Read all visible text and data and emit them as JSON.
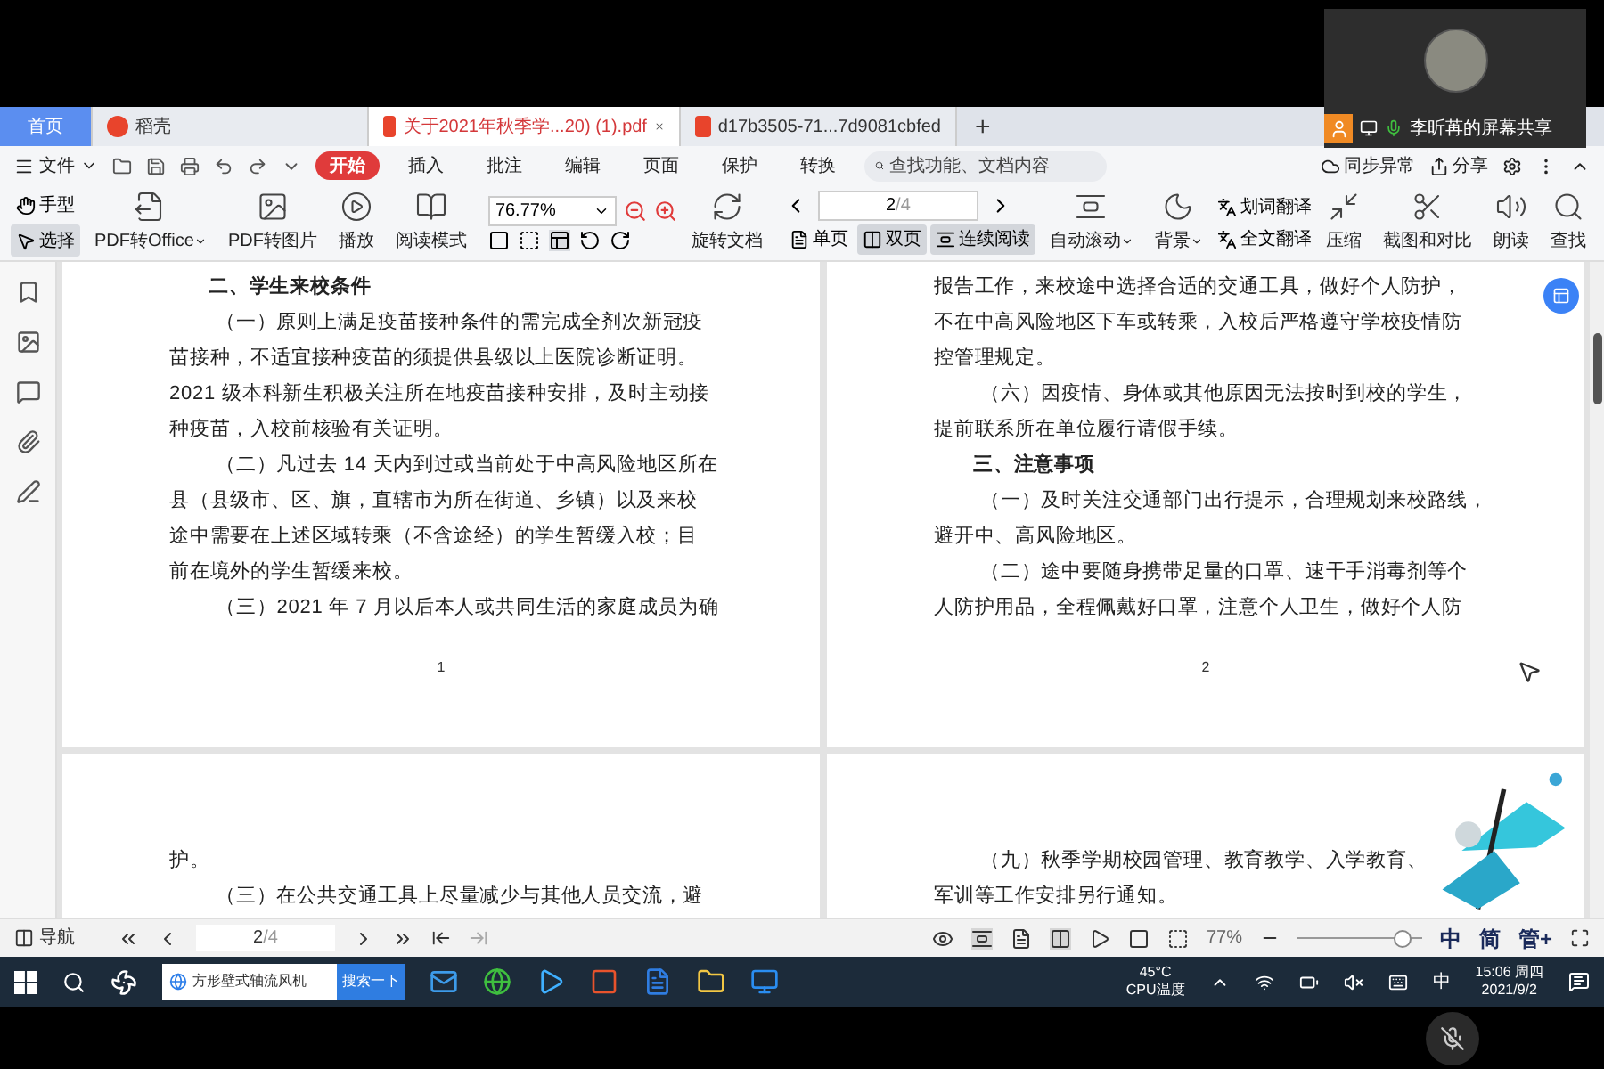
{
  "screen_share": {
    "label": "李昕苒的屏幕共享"
  },
  "tabs": [
    {
      "label": "首页",
      "kind": "home",
      "selected": false
    },
    {
      "label": "稻壳",
      "kind": "docer",
      "selected": false
    },
    {
      "label": "关于2021年秋季学...20) (1).pdf",
      "kind": "pdf",
      "selected": true
    },
    {
      "label": "d17b3505-71...7d9081cbfed",
      "kind": "pdf",
      "selected": false
    }
  ],
  "new_tab": "+",
  "menu": {
    "file": "文件",
    "items": [
      {
        "label": "开始",
        "selected": true
      },
      {
        "label": "插入",
        "selected": false
      },
      {
        "label": "批注",
        "selected": false
      },
      {
        "label": "编辑",
        "selected": false
      },
      {
        "label": "页面",
        "selected": false
      },
      {
        "label": "保护",
        "selected": false
      },
      {
        "label": "转换",
        "selected": false
      }
    ],
    "search_placeholder": "查找功能、文档内容",
    "sync": "同步异常",
    "share": "分享"
  },
  "toolbar": {
    "cursor_tools": [
      {
        "label": "手型",
        "selected": false
      },
      {
        "label": "选择",
        "selected": true
      }
    ],
    "buttons_a": [
      {
        "label": "PDF转Office",
        "dropdown": true
      },
      {
        "label": "PDF转图片",
        "dropdown": false
      },
      {
        "label": "播放",
        "dropdown": false
      },
      {
        "label": "阅读模式",
        "dropdown": false
      }
    ],
    "zoom": "76.77%",
    "rotate": "旋转文档",
    "page_current": "2",
    "page_total": "/4",
    "view_modes": [
      {
        "label": "单页",
        "selected": false
      },
      {
        "label": "双页",
        "selected": true
      },
      {
        "label": "连续阅读",
        "selected": true
      }
    ],
    "buttons_b": [
      {
        "label": "自动滚动",
        "dropdown": true
      },
      {
        "label": "背景",
        "dropdown": true
      }
    ],
    "translate": [
      {
        "label": "划词翻译"
      },
      {
        "label": "全文翻译"
      }
    ],
    "buttons_c": [
      {
        "label": "压缩",
        "dropdown": false
      },
      {
        "label": "截图和对比",
        "dropdown": false
      },
      {
        "label": "朗读",
        "dropdown": false
      },
      {
        "label": "查找",
        "dropdown": false
      }
    ]
  },
  "pages": [
    {
      "page_number": "1",
      "lines": [
        {
          "kind": "heading",
          "text": "二、学生来校条件"
        },
        {
          "kind": "indent",
          "text": "（一）原则上满足疫苗接种条件的需完成全剂次新冠疫"
        },
        {
          "kind": "plain",
          "text": "苗接种，不适宜接种疫苗的须提供县级以上医院诊断证明。"
        },
        {
          "kind": "plain",
          "text": "2021 级本科新生积极关注所在地疫苗接种安排，及时主动接"
        },
        {
          "kind": "plain",
          "text": "种疫苗，入校前核验有关证明。"
        },
        {
          "kind": "indent",
          "text": "（二）凡过去 14 天内到过或当前处于中高风险地区所在"
        },
        {
          "kind": "plain",
          "text": "县（县级市、区、旗，直辖市为所在街道、乡镇）以及来校"
        },
        {
          "kind": "plain",
          "text": "途中需要在上述区域转乘（不含途经）的学生暂缓入校；目"
        },
        {
          "kind": "plain",
          "text": "前在境外的学生暂缓来校。"
        },
        {
          "kind": "indent",
          "text": "（三）2021 年 7 月以后本人或共同生活的家庭成员为确"
        }
      ]
    },
    {
      "page_number": "2",
      "lines": [
        {
          "kind": "plain",
          "text": "报告工作，来校途中选择合适的交通工具，做好个人防护，"
        },
        {
          "kind": "plain",
          "text": "不在中高风险地区下车或转乘，入校后严格遵守学校疫情防"
        },
        {
          "kind": "plain",
          "text": "控管理规定。"
        },
        {
          "kind": "indent",
          "text": "（六）因疫情、身体或其他原因无法按时到校的学生，"
        },
        {
          "kind": "plain",
          "text": "提前联系所在单位履行请假手续。"
        },
        {
          "kind": "heading",
          "text": "三、注意事项"
        },
        {
          "kind": "indent",
          "text": "（一）及时关注交通部门出行提示，合理规划来校路线，"
        },
        {
          "kind": "plain",
          "text": "避开中、高风险地区。"
        },
        {
          "kind": "indent",
          "text": "（二）途中要随身携带足量的口罩、速干手消毒剂等个"
        },
        {
          "kind": "plain",
          "text": "人防护用品，全程佩戴好口罩，注意个人卫生，做好个人防"
        }
      ]
    },
    {
      "lines": [
        {
          "kind": "plain",
          "text": "护。"
        },
        {
          "kind": "indent",
          "text": "（三）在公共交通工具上尽量减少与其他人员交流，避"
        }
      ]
    },
    {
      "lines": [
        {
          "kind": "indent",
          "text": "（九）秋季学期校园管理、教育教学、入学教育、"
        },
        {
          "kind": "plain",
          "text": "军训等工作安排另行通知。"
        }
      ]
    }
  ],
  "status_bar": {
    "nav": "导航",
    "page_current": "2",
    "page_total": "/4",
    "zoom": "77%",
    "zoom_slider": {
      "level": 0.85
    },
    "ime": [
      "中",
      "简",
      "管+"
    ]
  },
  "taskbar": {
    "search_value": "方形壁式轴流风机",
    "search_button": "搜索一下",
    "temp": "45°C",
    "temp_label": "CPU温度",
    "ime": "中",
    "time": "15:06 周四",
    "date": "2021/9/2"
  }
}
